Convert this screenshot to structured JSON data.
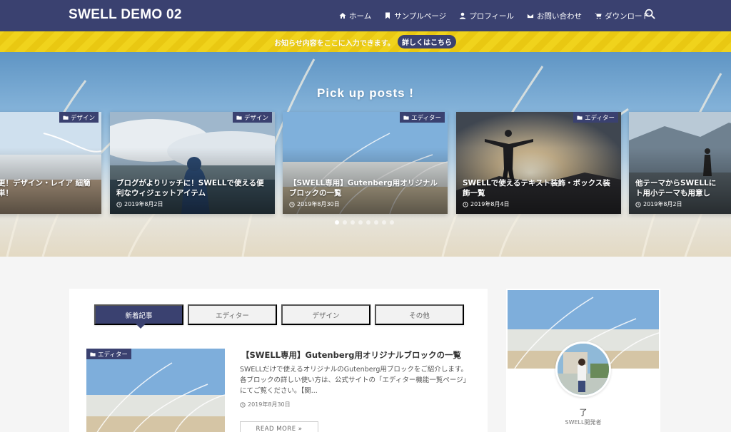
{
  "header": {
    "site_title": "SWELL DEMO 02",
    "nav": [
      {
        "label": "ホーム",
        "icon": "home-icon"
      },
      {
        "label": "サンプルページ",
        "icon": "bookmark-icon"
      },
      {
        "label": "プロフィール",
        "icon": "user-icon"
      },
      {
        "label": "お問い合わせ",
        "icon": "mail-icon"
      },
      {
        "label": "ダウンロード",
        "icon": "cart-icon"
      }
    ],
    "search_icon": "search-icon"
  },
  "notice": {
    "text": "お知らせ内容をここに入力できます。",
    "button": "詳しくはこちら"
  },
  "pickup": {
    "title": "Pick up posts !",
    "cards": [
      {
        "category": "デザイン",
        "title": "更！デザイン・レイア\n細簡単！",
        "date": ""
      },
      {
        "category": "デザイン",
        "title": "ブログがよりリッチに！SWELLで使える便利なウィジェットアイテム",
        "date": "2019年8月2日"
      },
      {
        "category": "エディター",
        "title": "【SWELL専用】Gutenberg用オリジナルブロックの一覧",
        "date": "2019年8月30日"
      },
      {
        "category": "エディター",
        "title": "SWELLで使えるテキスト装飾・ボックス装飾一覧",
        "date": "2019年8月4日"
      },
      {
        "category": "",
        "title": "他テーマからSWELLにト用小テーマも用意し",
        "date": "2019年8月2日"
      }
    ],
    "dots_count": 8,
    "active_dot": 0
  },
  "tabs": [
    "新着記事",
    "エディター",
    "デザイン",
    "その他"
  ],
  "post": {
    "category": "エディター",
    "title": "【SWELL専用】Gutenberg用オリジナルブロックの一覧",
    "excerpt": "SWELLだけで使えるオリジナルのGutenberg用ブロックをご紹介します。各ブロックの詳しい使い方は、公式サイトの「エディター機能一覧ページ」にてご覧ください。【関...",
    "date": "2019年8月30日",
    "readmore": "READ MORE »"
  },
  "profile": {
    "name": "了",
    "role": "SWELL開発者"
  },
  "colors": {
    "header_bg": "#3a4170",
    "notice_yellow": "#f0d31c",
    "accent": "#3a4170"
  }
}
